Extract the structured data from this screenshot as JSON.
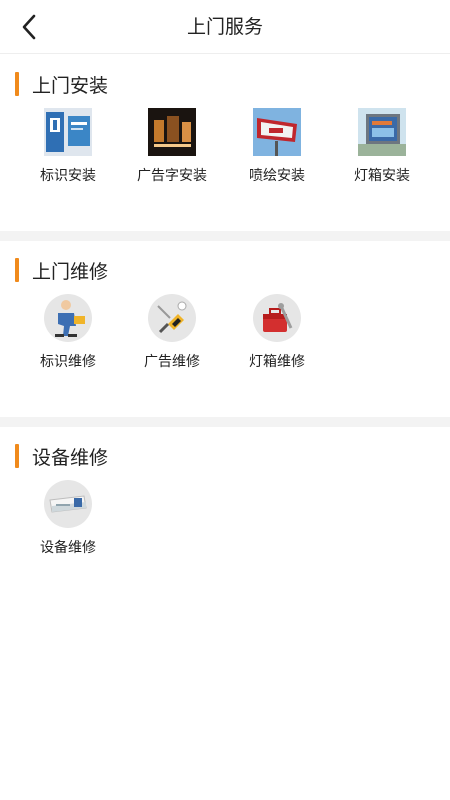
{
  "header": {
    "title": "上门服务"
  },
  "sections": [
    {
      "title": "上门安装",
      "items": [
        {
          "label": "标识安装",
          "icon": "signage-photo"
        },
        {
          "label": "广告字安装",
          "icon": "led-letters-photo"
        },
        {
          "label": "喷绘安装",
          "icon": "billboard-photo"
        },
        {
          "label": "灯箱安装",
          "icon": "lightbox-photo"
        }
      ]
    },
    {
      "title": "上门维修",
      "items": [
        {
          "label": "标识维修",
          "icon": "repairman-icon"
        },
        {
          "label": "广告维修",
          "icon": "screwdriver-icon"
        },
        {
          "label": "灯箱维修",
          "icon": "toolbox-icon"
        }
      ]
    },
    {
      "title": "设备维修",
      "items": [
        {
          "label": "设备维修",
          "icon": "machine-icon"
        }
      ]
    }
  ],
  "colors": {
    "accent": "#f08a1c",
    "divider": "#f3f3f3"
  }
}
